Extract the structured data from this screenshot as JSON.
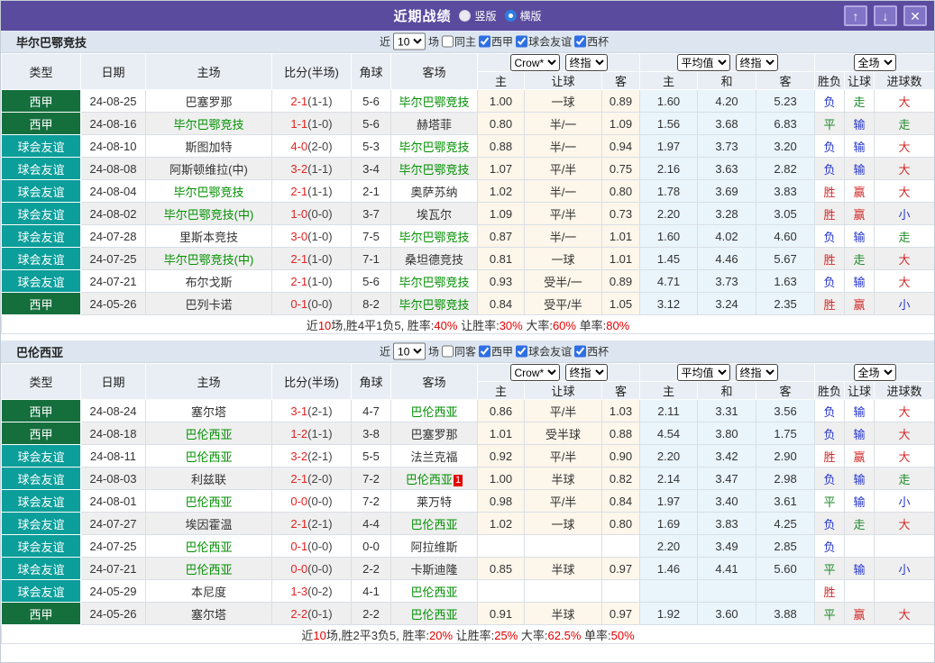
{
  "colors": {
    "titlebar_bg": "#5a4b9e",
    "liga_bg": "#156f3d",
    "friendly_bg": "#0b9e9a",
    "score_red": "#e52222",
    "team_green": "#009000",
    "result_red": "#d42a2a",
    "result_blue": "#2636cc",
    "result_green": "#1d8a2a"
  },
  "titlebar": {
    "title": "近期战绩",
    "vertical_label": "竖版",
    "horizontal_label": "横版",
    "up_icon": "↑",
    "down_icon": "↓",
    "close_icon": "✕"
  },
  "header": {
    "type": "类型",
    "date": "日期",
    "home": "主场",
    "score": "比分(半场)",
    "corner": "角球",
    "away": "客场",
    "crow_select": "Crow*",
    "final_select": "终指",
    "avg_select": "平均值",
    "final_select2": "终指",
    "full_select": "全场",
    "h": "主",
    "handicap": "让球",
    "a": "客",
    "avg_h": "主",
    "avg_d": "和",
    "avg_a": "客",
    "wdl": "胜负",
    "let_goal": "让球",
    "goals": "进球数"
  },
  "sections": [
    {
      "team": "毕尔巴鄂竞技",
      "filter": {
        "near": "近",
        "count": "10",
        "games": "场",
        "same": "同主",
        "same_checked": false,
        "leagues": [
          {
            "label": "西甲",
            "checked": true
          },
          {
            "label": "球会友谊",
            "checked": true
          },
          {
            "label": "西杯",
            "checked": true
          }
        ]
      },
      "rows": [
        {
          "type": "西甲",
          "type_key": "liga",
          "date": "24-08-25",
          "home": "巴塞罗那",
          "home_self": false,
          "score": "2-1",
          "half": "(1-1)",
          "corner": "5-6",
          "away": "毕尔巴鄂竞技",
          "away_self": true,
          "away_card": "",
          "h": "1.00",
          "hc": "一球",
          "a": "0.89",
          "m1": "1.60",
          "m2": "4.20",
          "m3": "5.23",
          "r1": "负",
          "r1c": "blue",
          "r2": "走",
          "r2c": "green",
          "r3": "大",
          "r3c": "red"
        },
        {
          "type": "西甲",
          "type_key": "liga",
          "date": "24-08-16",
          "home": "毕尔巴鄂竞技",
          "home_self": true,
          "score": "1-1",
          "half": "(1-0)",
          "corner": "5-6",
          "away": "赫塔菲",
          "away_self": false,
          "away_card": "",
          "h": "0.80",
          "hc": "半/一",
          "a": "1.09",
          "m1": "1.56",
          "m2": "3.68",
          "m3": "6.83",
          "r1": "平",
          "r1c": "green",
          "r2": "输",
          "r2c": "blue",
          "r3": "走",
          "r3c": "green"
        },
        {
          "type": "球会友谊",
          "type_key": "friendly",
          "date": "24-08-10",
          "home": "斯图加特",
          "home_self": false,
          "score": "4-0",
          "half": "(2-0)",
          "corner": "5-3",
          "away": "毕尔巴鄂竞技",
          "away_self": true,
          "away_card": "",
          "h": "0.88",
          "hc": "半/一",
          "a": "0.94",
          "m1": "1.97",
          "m2": "3.73",
          "m3": "3.20",
          "r1": "负",
          "r1c": "blue",
          "r2": "输",
          "r2c": "blue",
          "r3": "大",
          "r3c": "red"
        },
        {
          "type": "球会友谊",
          "type_key": "friendly",
          "date": "24-08-08",
          "home": "阿斯顿维拉(中)",
          "home_self": false,
          "score": "3-2",
          "half": "(1-1)",
          "corner": "3-4",
          "away": "毕尔巴鄂竞技",
          "away_self": true,
          "away_card": "",
          "h": "1.07",
          "hc": "平/半",
          "a": "0.75",
          "m1": "2.16",
          "m2": "3.63",
          "m3": "2.82",
          "r1": "负",
          "r1c": "blue",
          "r2": "输",
          "r2c": "blue",
          "r3": "大",
          "r3c": "red"
        },
        {
          "type": "球会友谊",
          "type_key": "friendly",
          "date": "24-08-04",
          "home": "毕尔巴鄂竞技",
          "home_self": true,
          "score": "2-1",
          "half": "(1-1)",
          "corner": "2-1",
          "away": "奥萨苏纳",
          "away_self": false,
          "away_card": "",
          "h": "1.02",
          "hc": "半/一",
          "a": "0.80",
          "m1": "1.78",
          "m2": "3.69",
          "m3": "3.83",
          "r1": "胜",
          "r1c": "red",
          "r2": "赢",
          "r2c": "red",
          "r3": "大",
          "r3c": "red"
        },
        {
          "type": "球会友谊",
          "type_key": "friendly",
          "date": "24-08-02",
          "home": "毕尔巴鄂竞技(中)",
          "home_self": true,
          "score": "1-0",
          "half": "(0-0)",
          "corner": "3-7",
          "away": "埃瓦尔",
          "away_self": false,
          "away_card": "",
          "h": "1.09",
          "hc": "平/半",
          "a": "0.73",
          "m1": "2.20",
          "m2": "3.28",
          "m3": "3.05",
          "r1": "胜",
          "r1c": "red",
          "r2": "赢",
          "r2c": "red",
          "r3": "小",
          "r3c": "blue"
        },
        {
          "type": "球会友谊",
          "type_key": "friendly",
          "date": "24-07-28",
          "home": "里斯本竞技",
          "home_self": false,
          "score": "3-0",
          "half": "(1-0)",
          "corner": "7-5",
          "away": "毕尔巴鄂竞技",
          "away_self": true,
          "away_card": "",
          "h": "0.87",
          "hc": "半/一",
          "a": "1.01",
          "m1": "1.60",
          "m2": "4.02",
          "m3": "4.60",
          "r1": "负",
          "r1c": "blue",
          "r2": "输",
          "r2c": "blue",
          "r3": "走",
          "r3c": "green"
        },
        {
          "type": "球会友谊",
          "type_key": "friendly",
          "date": "24-07-25",
          "home": "毕尔巴鄂竞技(中)",
          "home_self": true,
          "score": "2-1",
          "half": "(1-0)",
          "corner": "7-1",
          "away": "桑坦德竞技",
          "away_self": false,
          "away_card": "",
          "h": "0.81",
          "hc": "一球",
          "a": "1.01",
          "m1": "1.45",
          "m2": "4.46",
          "m3": "5.67",
          "r1": "胜",
          "r1c": "red",
          "r2": "走",
          "r2c": "green",
          "r3": "大",
          "r3c": "red"
        },
        {
          "type": "球会友谊",
          "type_key": "friendly",
          "date": "24-07-21",
          "home": "布尔戈斯",
          "home_self": false,
          "score": "2-1",
          "half": "(1-0)",
          "corner": "5-6",
          "away": "毕尔巴鄂竞技",
          "away_self": true,
          "away_card": "",
          "h": "0.93",
          "hc": "受半/一",
          "a": "0.89",
          "m1": "4.71",
          "m2": "3.73",
          "m3": "1.63",
          "r1": "负",
          "r1c": "blue",
          "r2": "输",
          "r2c": "blue",
          "r3": "大",
          "r3c": "red"
        },
        {
          "type": "西甲",
          "type_key": "liga",
          "date": "24-05-26",
          "home": "巴列卡诺",
          "home_self": false,
          "score": "0-1",
          "half": "(0-0)",
          "corner": "8-2",
          "away": "毕尔巴鄂竞技",
          "away_self": true,
          "away_card": "",
          "h": "0.84",
          "hc": "受平/半",
          "a": "1.05",
          "m1": "3.12",
          "m2": "3.24",
          "m3": "2.35",
          "r1": "胜",
          "r1c": "red",
          "r2": "赢",
          "r2c": "red",
          "r3": "小",
          "r3c": "blue"
        }
      ],
      "summary": [
        {
          "t": "近"
        },
        {
          "t": "10",
          "hot": true
        },
        {
          "t": "场,胜4平1负5, 胜率:"
        },
        {
          "t": "40%",
          "hot": true
        },
        {
          "t": " 让胜率:"
        },
        {
          "t": "30%",
          "hot": true
        },
        {
          "t": " 大率:"
        },
        {
          "t": "60%",
          "hot": true
        },
        {
          "t": " 单率:"
        },
        {
          "t": "80%",
          "hot": true
        }
      ]
    },
    {
      "team": "巴伦西亚",
      "filter": {
        "near": "近",
        "count": "10",
        "games": "场",
        "same": "同客",
        "same_checked": false,
        "leagues": [
          {
            "label": "西甲",
            "checked": true
          },
          {
            "label": "球会友谊",
            "checked": true
          },
          {
            "label": "西杯",
            "checked": true
          }
        ]
      },
      "rows": [
        {
          "type": "西甲",
          "type_key": "liga",
          "date": "24-08-24",
          "home": "塞尔塔",
          "home_self": false,
          "score": "3-1",
          "half": "(2-1)",
          "corner": "4-7",
          "away": "巴伦西亚",
          "away_self": true,
          "away_card": "",
          "h": "0.86",
          "hc": "平/半",
          "a": "1.03",
          "m1": "2.11",
          "m2": "3.31",
          "m3": "3.56",
          "r1": "负",
          "r1c": "blue",
          "r2": "输",
          "r2c": "blue",
          "r3": "大",
          "r3c": "red"
        },
        {
          "type": "西甲",
          "type_key": "liga",
          "date": "24-08-18",
          "home": "巴伦西亚",
          "home_self": true,
          "score": "1-2",
          "half": "(1-1)",
          "corner": "3-8",
          "away": "巴塞罗那",
          "away_self": false,
          "away_card": "",
          "h": "1.01",
          "hc": "受半球",
          "a": "0.88",
          "m1": "4.54",
          "m2": "3.80",
          "m3": "1.75",
          "r1": "负",
          "r1c": "blue",
          "r2": "输",
          "r2c": "blue",
          "r3": "大",
          "r3c": "red"
        },
        {
          "type": "球会友谊",
          "type_key": "friendly",
          "date": "24-08-11",
          "home": "巴伦西亚",
          "home_self": true,
          "score": "3-2",
          "half": "(2-1)",
          "corner": "5-5",
          "away": "法兰克福",
          "away_self": false,
          "away_card": "",
          "h": "0.92",
          "hc": "平/半",
          "a": "0.90",
          "m1": "2.20",
          "m2": "3.42",
          "m3": "2.90",
          "r1": "胜",
          "r1c": "red",
          "r2": "赢",
          "r2c": "red",
          "r3": "大",
          "r3c": "red"
        },
        {
          "type": "球会友谊",
          "type_key": "friendly",
          "date": "24-08-03",
          "home": "利兹联",
          "home_self": false,
          "score": "2-1",
          "half": "(2-0)",
          "corner": "7-2",
          "away": "巴伦西亚",
          "away_self": true,
          "away_card": "1",
          "h": "1.00",
          "hc": "半球",
          "a": "0.82",
          "m1": "2.14",
          "m2": "3.47",
          "m3": "2.98",
          "r1": "负",
          "r1c": "blue",
          "r2": "输",
          "r2c": "blue",
          "r3": "走",
          "r3c": "green"
        },
        {
          "type": "球会友谊",
          "type_key": "friendly",
          "date": "24-08-01",
          "home": "巴伦西亚",
          "home_self": true,
          "score": "0-0",
          "half": "(0-0)",
          "corner": "7-2",
          "away": "莱万特",
          "away_self": false,
          "away_card": "",
          "h": "0.98",
          "hc": "平/半",
          "a": "0.84",
          "m1": "1.97",
          "m2": "3.40",
          "m3": "3.61",
          "r1": "平",
          "r1c": "green",
          "r2": "输",
          "r2c": "blue",
          "r3": "小",
          "r3c": "blue"
        },
        {
          "type": "球会友谊",
          "type_key": "friendly",
          "date": "24-07-27",
          "home": "埃因霍温",
          "home_self": false,
          "score": "2-1",
          "half": "(2-1)",
          "corner": "4-4",
          "away": "巴伦西亚",
          "away_self": true,
          "away_card": "",
          "h": "1.02",
          "hc": "一球",
          "a": "0.80",
          "m1": "1.69",
          "m2": "3.83",
          "m3": "4.25",
          "r1": "负",
          "r1c": "blue",
          "r2": "走",
          "r2c": "green",
          "r3": "大",
          "r3c": "red"
        },
        {
          "type": "球会友谊",
          "type_key": "friendly",
          "date": "24-07-25",
          "home": "巴伦西亚",
          "home_self": true,
          "score": "0-1",
          "half": "(0-0)",
          "corner": "0-0",
          "away": "阿拉维斯",
          "away_self": false,
          "away_card": "",
          "h": "",
          "hc": "",
          "a": "",
          "m1": "2.20",
          "m2": "3.49",
          "m3": "2.85",
          "r1": "负",
          "r1c": "blue",
          "r2": "",
          "r2c": "",
          "r3": "",
          "r3c": ""
        },
        {
          "type": "球会友谊",
          "type_key": "friendly",
          "date": "24-07-21",
          "home": "巴伦西亚",
          "home_self": true,
          "score": "0-0",
          "half": "(0-0)",
          "corner": "2-2",
          "away": "卡斯迪隆",
          "away_self": false,
          "away_card": "",
          "h": "0.85",
          "hc": "半球",
          "a": "0.97",
          "m1": "1.46",
          "m2": "4.41",
          "m3": "5.60",
          "r1": "平",
          "r1c": "green",
          "r2": "输",
          "r2c": "blue",
          "r3": "小",
          "r3c": "blue"
        },
        {
          "type": "球会友谊",
          "type_key": "friendly",
          "date": "24-05-29",
          "home": "本尼度",
          "home_self": false,
          "score": "1-3",
          "half": "(0-2)",
          "corner": "4-1",
          "away": "巴伦西亚",
          "away_self": true,
          "away_card": "",
          "h": "",
          "hc": "",
          "a": "",
          "m1": "",
          "m2": "",
          "m3": "",
          "r1": "胜",
          "r1c": "red",
          "r2": "",
          "r2c": "",
          "r3": "",
          "r3c": ""
        },
        {
          "type": "西甲",
          "type_key": "liga",
          "date": "24-05-26",
          "home": "塞尔塔",
          "home_self": false,
          "score": "2-2",
          "half": "(0-1)",
          "corner": "2-2",
          "away": "巴伦西亚",
          "away_self": true,
          "away_card": "",
          "h": "0.91",
          "hc": "半球",
          "a": "0.97",
          "m1": "1.92",
          "m2": "3.60",
          "m3": "3.88",
          "r1": "平",
          "r1c": "green",
          "r2": "赢",
          "r2c": "red",
          "r3": "大",
          "r3c": "red"
        }
      ],
      "summary": [
        {
          "t": "近"
        },
        {
          "t": "10",
          "hot": true
        },
        {
          "t": "场,胜2平3负5, 胜率:"
        },
        {
          "t": "20%",
          "hot": true
        },
        {
          "t": " 让胜率:"
        },
        {
          "t": "25%",
          "hot": true
        },
        {
          "t": " 大率:"
        },
        {
          "t": "62.5%",
          "hot": true
        },
        {
          "t": " 单率:"
        },
        {
          "t": "50%",
          "hot": true
        }
      ]
    }
  ]
}
